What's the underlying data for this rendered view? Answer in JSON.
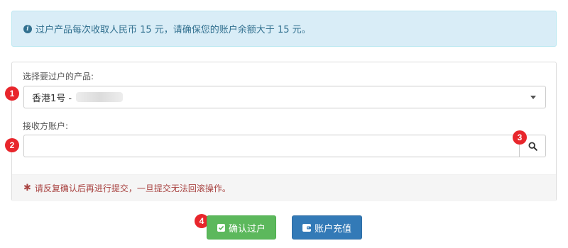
{
  "alert": {
    "text": "过户产品每次收取人民币 15 元，请确保您的账户余额大于 15 元。"
  },
  "form": {
    "product_label": "选择要过户的产品:",
    "product_selected": "香港1号 -",
    "account_label": "接收方账户:",
    "account_value": "",
    "warning": "请反复确认后再进行提交，一旦提交无法回滚操作。"
  },
  "badges": [
    "1",
    "2",
    "3",
    "4"
  ],
  "buttons": {
    "confirm": "确认过户",
    "recharge": "账户充值"
  },
  "colors": {
    "info_bg": "#d9edf7",
    "info_text": "#31708f",
    "danger": "#a94442",
    "success": "#5cb85c",
    "primary": "#337ab7",
    "badge": "#e8262c"
  },
  "icons": {
    "alert": "info-circle-icon",
    "select": "caret-down-icon",
    "search": "search-icon",
    "confirm": "check-square-icon",
    "recharge": "wallet-icon",
    "warning": "asterisk-icon"
  }
}
